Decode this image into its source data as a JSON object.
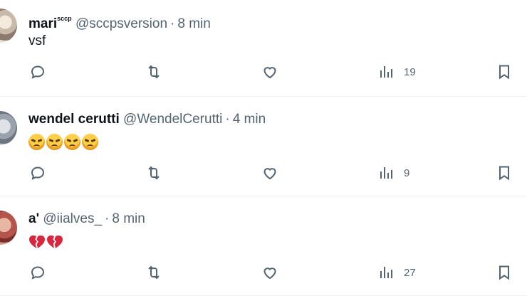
{
  "posts": [
    {
      "name": "mari",
      "name_sup": "sccp",
      "handle": "@sccpsversion",
      "separator": "·",
      "time": "8 min",
      "text": "vsf",
      "views": "19"
    },
    {
      "name": "wendel cerutti",
      "handle": "@WendelCerutti",
      "separator": "·",
      "time": "4 min",
      "emoji": [
        "angry-face",
        "angry-face",
        "angry-face",
        "angry-face"
      ],
      "views": "9"
    },
    {
      "name": "a'",
      "handle": "@iialves_",
      "separator": "·",
      "time": "8 min",
      "emoji": [
        "broken-heart",
        "broken-heart"
      ],
      "views": "27"
    }
  ],
  "icons": {
    "reply": "reply-icon",
    "retweet": "retweet-icon",
    "like": "heart-icon",
    "views": "views-chart-icon",
    "bookmark": "bookmark-icon"
  },
  "colors": {
    "text": "#0f1419",
    "secondary": "#536471",
    "divider": "#eff3f4",
    "heart_red": "#d7263d"
  }
}
